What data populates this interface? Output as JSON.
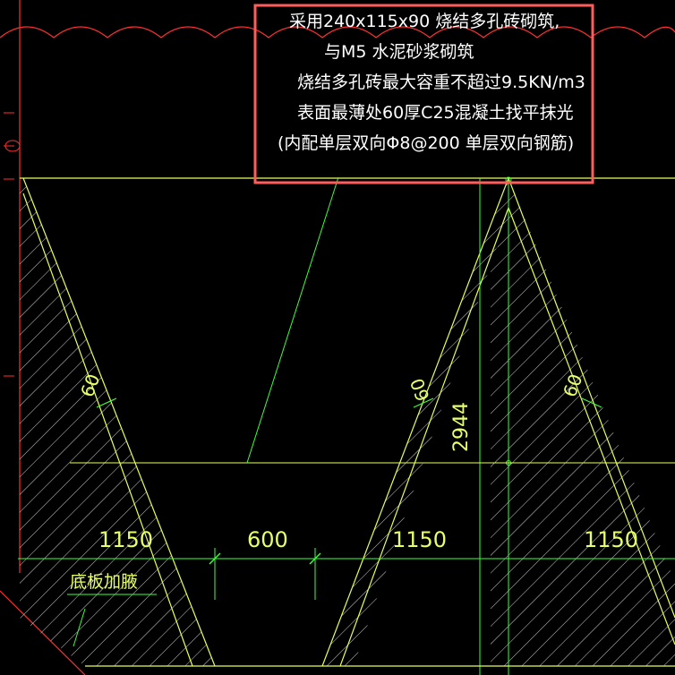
{
  "note": {
    "lines": [
      "采用240x115x90    烧结多孔砖砌筑,",
      "与M5 水泥砂浆砌筑",
      "烧结多孔砖最大容重不超过9.5KN/m3",
      "表面最薄处60厚C25混凝土找平抹光",
      "(内配单层双向Φ8@200  单层双向钢筋)"
    ],
    "highlight_color": "#ff5c5c"
  },
  "dimensions": {
    "bottom": [
      "1150",
      "600",
      "1150",
      "1150"
    ],
    "height": "2944",
    "thickness": [
      "60",
      "60",
      "60"
    ]
  },
  "label": {
    "text": "底板加腋"
  },
  "colors": {
    "background": "#000000",
    "line_yellow": "#e8ff5a",
    "line_green": "#3cff3c",
    "hatch": "#ffffff",
    "border_red": "#ff3030"
  }
}
